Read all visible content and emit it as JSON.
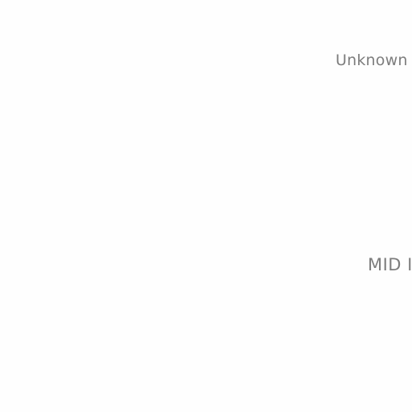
{
  "screen": {
    "background": "#fefefe",
    "text_color": "#7d7d7d"
  },
  "labels": {
    "top": "Unknown",
    "middle": "MID I"
  }
}
